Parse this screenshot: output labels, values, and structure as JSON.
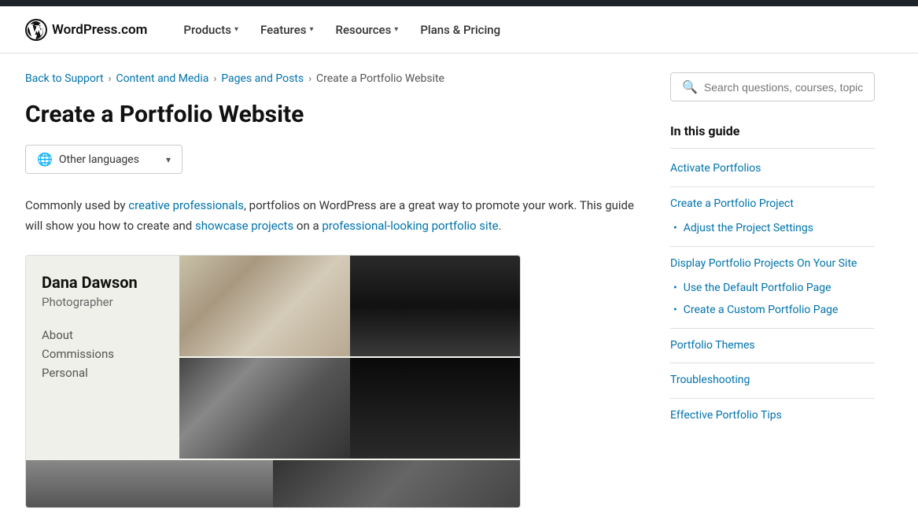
{
  "topbar": {},
  "navbar": {
    "logo_text": "WordPress.com",
    "items": [
      {
        "label": "Products",
        "has_dropdown": true
      },
      {
        "label": "Features",
        "has_dropdown": true
      },
      {
        "label": "Resources",
        "has_dropdown": true
      },
      {
        "label": "Plans & Pricing",
        "has_dropdown": false
      }
    ]
  },
  "breadcrumb": {
    "items": [
      {
        "label": "Back to Support",
        "link": true
      },
      {
        "label": "Content and Media",
        "link": true
      },
      {
        "label": "Pages and Posts",
        "link": true
      },
      {
        "label": "Create a Portfolio Website",
        "link": false
      }
    ],
    "separator": "›"
  },
  "page": {
    "title": "Create a Portfolio Website",
    "language_dropdown_label": "Other languages",
    "intro_text_1": "Commonly used by ",
    "intro_link_1": "creative professionals",
    "intro_text_2": ", portfolios on WordPress are a great way to promote your work. This guide will show you how to create and ",
    "intro_link_2": "showcase projects",
    "intro_text_3": " on a ",
    "intro_link_3": "professional-looking portfolio site",
    "intro_text_4": "."
  },
  "portfolio_preview": {
    "name": "Dana Dawson",
    "role": "Photographer",
    "nav_items": [
      "About",
      "Commissions",
      "Personal"
    ]
  },
  "search": {
    "placeholder": "Search questions, courses, topics"
  },
  "guide": {
    "title": "In this guide",
    "items": [
      {
        "label": "Activate Portfolios",
        "has_sub": false,
        "sub_items": []
      },
      {
        "label": "Create a Portfolio Project",
        "has_sub": true,
        "sub_items": [
          {
            "label": "Adjust the Project Settings"
          }
        ]
      },
      {
        "label": "Display Portfolio Projects On Your Site",
        "has_sub": true,
        "sub_items": [
          {
            "label": "Use the Default Portfolio Page"
          },
          {
            "label": "Create a Custom Portfolio Page"
          }
        ]
      },
      {
        "label": "Portfolio Themes",
        "has_sub": false,
        "sub_items": []
      },
      {
        "label": "Troubleshooting",
        "has_sub": false,
        "sub_items": []
      },
      {
        "label": "Effective Portfolio Tips",
        "has_sub": false,
        "sub_items": []
      }
    ]
  }
}
